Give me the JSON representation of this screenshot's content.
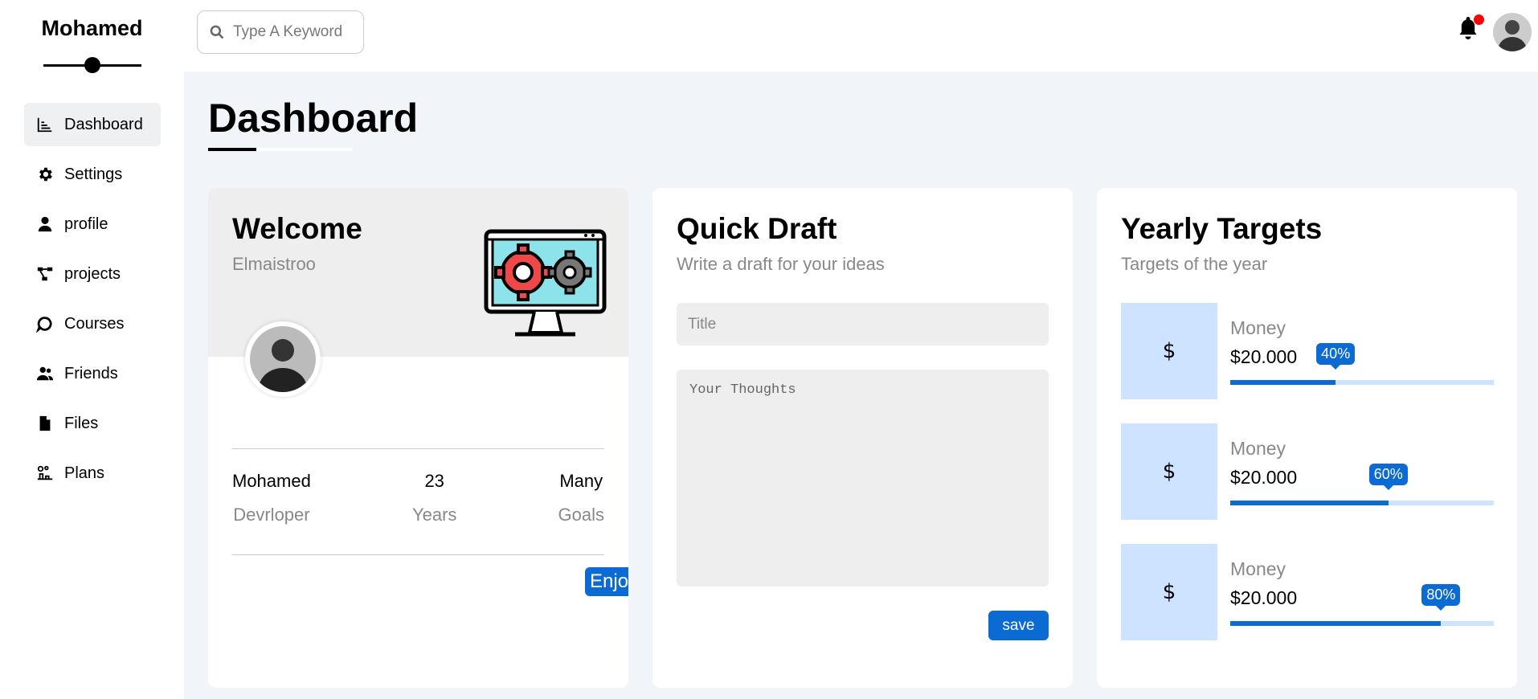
{
  "brand": {
    "name": "Mohamed"
  },
  "sidebar": {
    "items": [
      {
        "label": "Dashboard",
        "icon": "chart-icon",
        "active": true
      },
      {
        "label": "Settings",
        "icon": "gear-icon"
      },
      {
        "label": "profile",
        "icon": "user-icon"
      },
      {
        "label": "projects",
        "icon": "diagram-icon"
      },
      {
        "label": "Courses",
        "icon": "chat-icon"
      },
      {
        "label": "Friends",
        "icon": "users-icon"
      },
      {
        "label": "Files",
        "icon": "file-icon"
      },
      {
        "label": "Plans",
        "icon": "plans-icon"
      }
    ]
  },
  "header": {
    "search_placeholder": "Type A Keyword",
    "notification_badge_color": "#ff0000"
  },
  "page": {
    "title": "Dashboard"
  },
  "welcome": {
    "title": "Welcome",
    "subtitle": "Elmaistroo",
    "stats": [
      {
        "value": "Mohamed",
        "label": "Devrloper"
      },
      {
        "value": "23",
        "label": "Years"
      },
      {
        "value": "Many",
        "label": "Goals"
      }
    ],
    "button": "Enjoy"
  },
  "draft": {
    "title": "Quick Draft",
    "subtitle": "Write a draft for your ideas",
    "title_placeholder": "Title",
    "body_placeholder": "Your Thoughts",
    "save": "save"
  },
  "targets": {
    "title": "Yearly Targets",
    "subtitle": "Targets of the year",
    "items": [
      {
        "icon": "$",
        "label": "Money",
        "amount": "$20.000",
        "percent": 40,
        "percent_label": "40%"
      },
      {
        "icon": "$",
        "label": "Money",
        "amount": "$20.000",
        "percent": 60,
        "percent_label": "60%"
      },
      {
        "icon": "$",
        "label": "Money",
        "amount": "$20.000",
        "percent": 80,
        "percent_label": "80%"
      }
    ]
  },
  "colors": {
    "accent": "#0b6bd3",
    "light_blue": "#cde3ff",
    "background": "#f1f5f9"
  }
}
